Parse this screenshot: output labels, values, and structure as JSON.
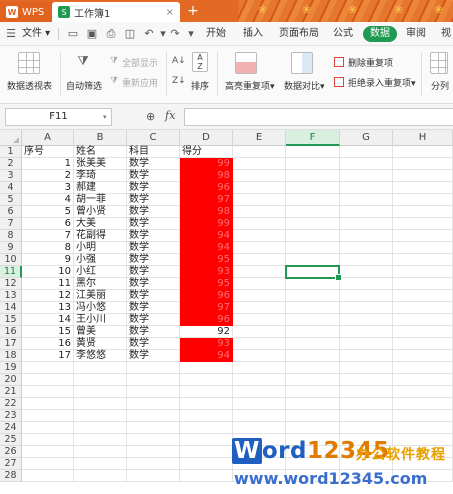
{
  "titlebar": {
    "wps_label": "WPS",
    "doc_tab": "工作簿1",
    "close_glyph": "×",
    "new_tab_glyph": "+"
  },
  "menubar": {
    "file_label": "文件",
    "tabs": [
      "开始",
      "插入",
      "页面布局",
      "公式",
      "数据",
      "审阅",
      "视"
    ],
    "active_tab": "数据"
  },
  "ribbon": {
    "pivot": "数据透视表",
    "autofilter": "自动筛选",
    "show_all": "全部显示",
    "reapply": "重新应用",
    "sort": "排序",
    "highlight_dup": "高亮重复项",
    "compare": "数据对比",
    "remove_dup": "删除重复项",
    "reject_dup": "拒绝录入重复项",
    "split": "分列",
    "dropdown_glyph": "▾"
  },
  "formula": {
    "cell_ref": "F11",
    "fx": "fx",
    "value": ""
  },
  "sheet": {
    "columns": [
      "A",
      "B",
      "C",
      "D",
      "E",
      "F",
      "G",
      "H"
    ],
    "selected_column": "F",
    "selected_row": 11,
    "rows_visible": 28,
    "header": [
      "序号",
      "姓名",
      "科目",
      "得分"
    ],
    "records": [
      [
        1,
        "张美美",
        "数学",
        99
      ],
      [
        2,
        "李琦",
        "数学",
        98
      ],
      [
        3,
        "郝建",
        "数学",
        96
      ],
      [
        4,
        "胡一菲",
        "数学",
        97
      ],
      [
        5,
        "曾小贤",
        "数学",
        98
      ],
      [
        6,
        "大美",
        "数学",
        99
      ],
      [
        7,
        "花副得",
        "数学",
        94
      ],
      [
        8,
        "小明",
        "数学",
        94
      ],
      [
        9,
        "小强",
        "数学",
        95
      ],
      [
        10,
        "小红",
        "数学",
        93
      ],
      [
        11,
        "黑尔",
        "数学",
        95
      ],
      [
        12,
        "江美丽",
        "数学",
        96
      ],
      [
        13,
        "冯小悠",
        "数学",
        97
      ],
      [
        14,
        "王小川",
        "数学",
        96
      ],
      [
        15,
        "曾美",
        "数学",
        92
      ],
      [
        16,
        "黄贤",
        "数学",
        93
      ],
      [
        17,
        "李悠悠",
        "数学",
        94
      ]
    ],
    "highlight_color": "#fe0000",
    "unhighlighted_record": 15
  },
  "watermark": {
    "brand_w": "W",
    "brand_ord": "ord",
    "brand_nums": "12345",
    "tagline": "办公软件教程",
    "url": "www.word12345.com"
  },
  "accent_color": "#1f9a53"
}
